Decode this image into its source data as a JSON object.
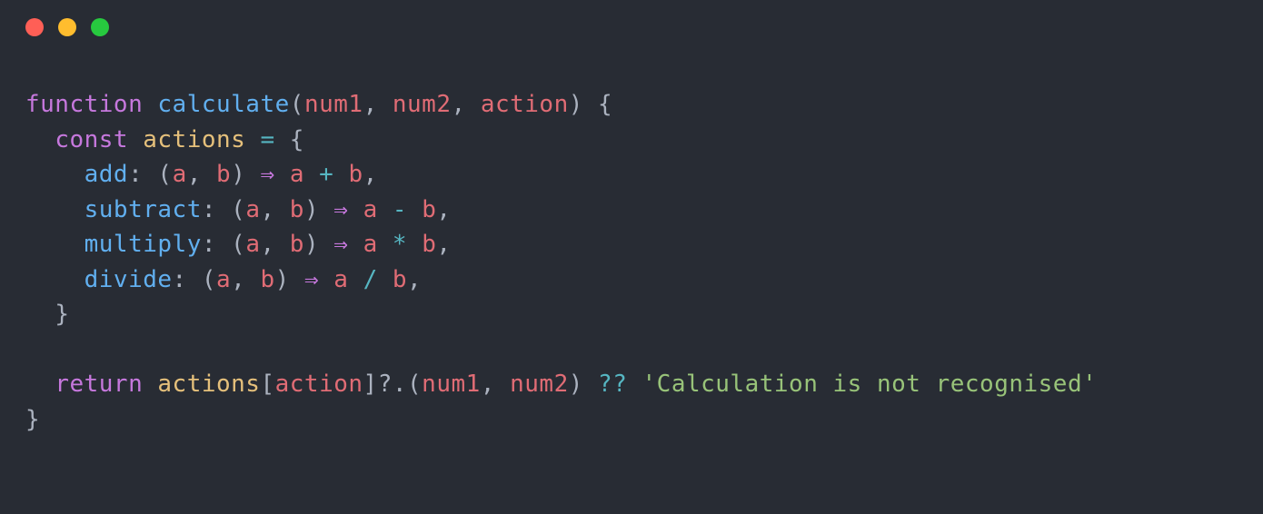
{
  "code": {
    "line1": {
      "function": "function",
      "name": "calculate",
      "open": "(",
      "p1": "num1",
      "c1": ", ",
      "p2": "num2",
      "c2": ", ",
      "p3": "action",
      "close": ")",
      "brace": " {"
    },
    "line2": {
      "indent": "  ",
      "const": "const",
      "sp": " ",
      "var": "actions",
      "eq": " = ",
      "brace": "{"
    },
    "line3": {
      "indent": "    ",
      "prop": "add",
      "colon": ": (",
      "a": "a",
      "c": ", ",
      "b": "b",
      "close": ") ",
      "arrow": "⇒",
      "sp": " ",
      "av": "a",
      "op": " + ",
      "bv": "b",
      "comma": ","
    },
    "line4": {
      "indent": "    ",
      "prop": "subtract",
      "colon": ": (",
      "a": "a",
      "c": ", ",
      "b": "b",
      "close": ") ",
      "arrow": "⇒",
      "sp": " ",
      "av": "a",
      "op": " - ",
      "bv": "b",
      "comma": ","
    },
    "line5": {
      "indent": "    ",
      "prop": "multiply",
      "colon": ": (",
      "a": "a",
      "c": ", ",
      "b": "b",
      "close": ") ",
      "arrow": "⇒",
      "sp": " ",
      "av": "a",
      "op": " * ",
      "bv": "b",
      "comma": ","
    },
    "line6": {
      "indent": "    ",
      "prop": "divide",
      "colon": ": (",
      "a": "a",
      "c": ", ",
      "b": "b",
      "close": ") ",
      "arrow": "⇒",
      "sp": " ",
      "av": "a",
      "op": " / ",
      "bv": "b",
      "comma": ","
    },
    "line7": {
      "indent": "  ",
      "brace": "}"
    },
    "line8": {
      "empty": ""
    },
    "line9": {
      "indent": "  ",
      "return": "return",
      "sp": " ",
      "var": "actions",
      "open": "[",
      "param": "action",
      "close": "]",
      "opt": "?.",
      "popen": "(",
      "p1": "num1",
      "c": ", ",
      "p2": "num2",
      "pclose": ") ",
      "null": "??",
      "sp2": " ",
      "str": "'Calculation is not recognised'"
    },
    "line10": {
      "brace": "}"
    }
  }
}
